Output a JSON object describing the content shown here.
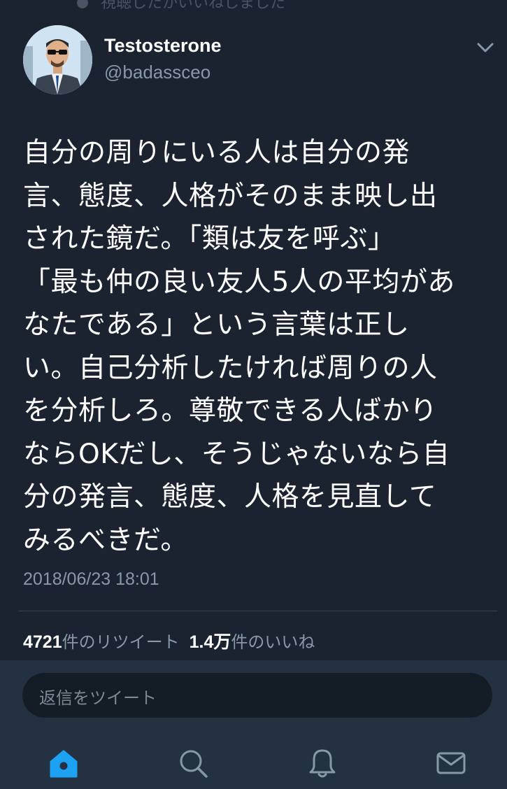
{
  "top": {
    "faded_text": "視聴したかいいねしました"
  },
  "author": {
    "name": "Testosterone",
    "handle": "@badassceo"
  },
  "tweet": {
    "text": "自分の周りにいる人は自分の発\n言、態度、人格がそのまま映し出\nされた鏡だ。「類は友を呼ぶ」\n「最も仲の良い友人5人の平均があ\nなたである」という言葉は正し\nい。自己分析したければ周りの人\nを分析しろ。尊敬できる人ばかり\nならOKだし、そうじゃないなら自\n分の発言、態度、人格を見直して\nみるべきだ。",
    "timestamp": "2018/06/23 18:01"
  },
  "stats": {
    "retweets_count": "4721",
    "retweets_label": "件のリツイート",
    "likes_count": "1.4万",
    "likes_label": "件のいいね"
  },
  "reply": {
    "placeholder": "返信をツイート"
  },
  "nav": {
    "items": [
      {
        "name": "home-icon",
        "active": true
      },
      {
        "name": "search-icon",
        "active": false
      },
      {
        "name": "notifications-icon",
        "active": false
      },
      {
        "name": "messages-icon",
        "active": false
      }
    ]
  },
  "colors": {
    "accent": "#1da1f2",
    "background": "#1b2230",
    "muted": "#8899a6",
    "nav_bar": "#243142"
  }
}
